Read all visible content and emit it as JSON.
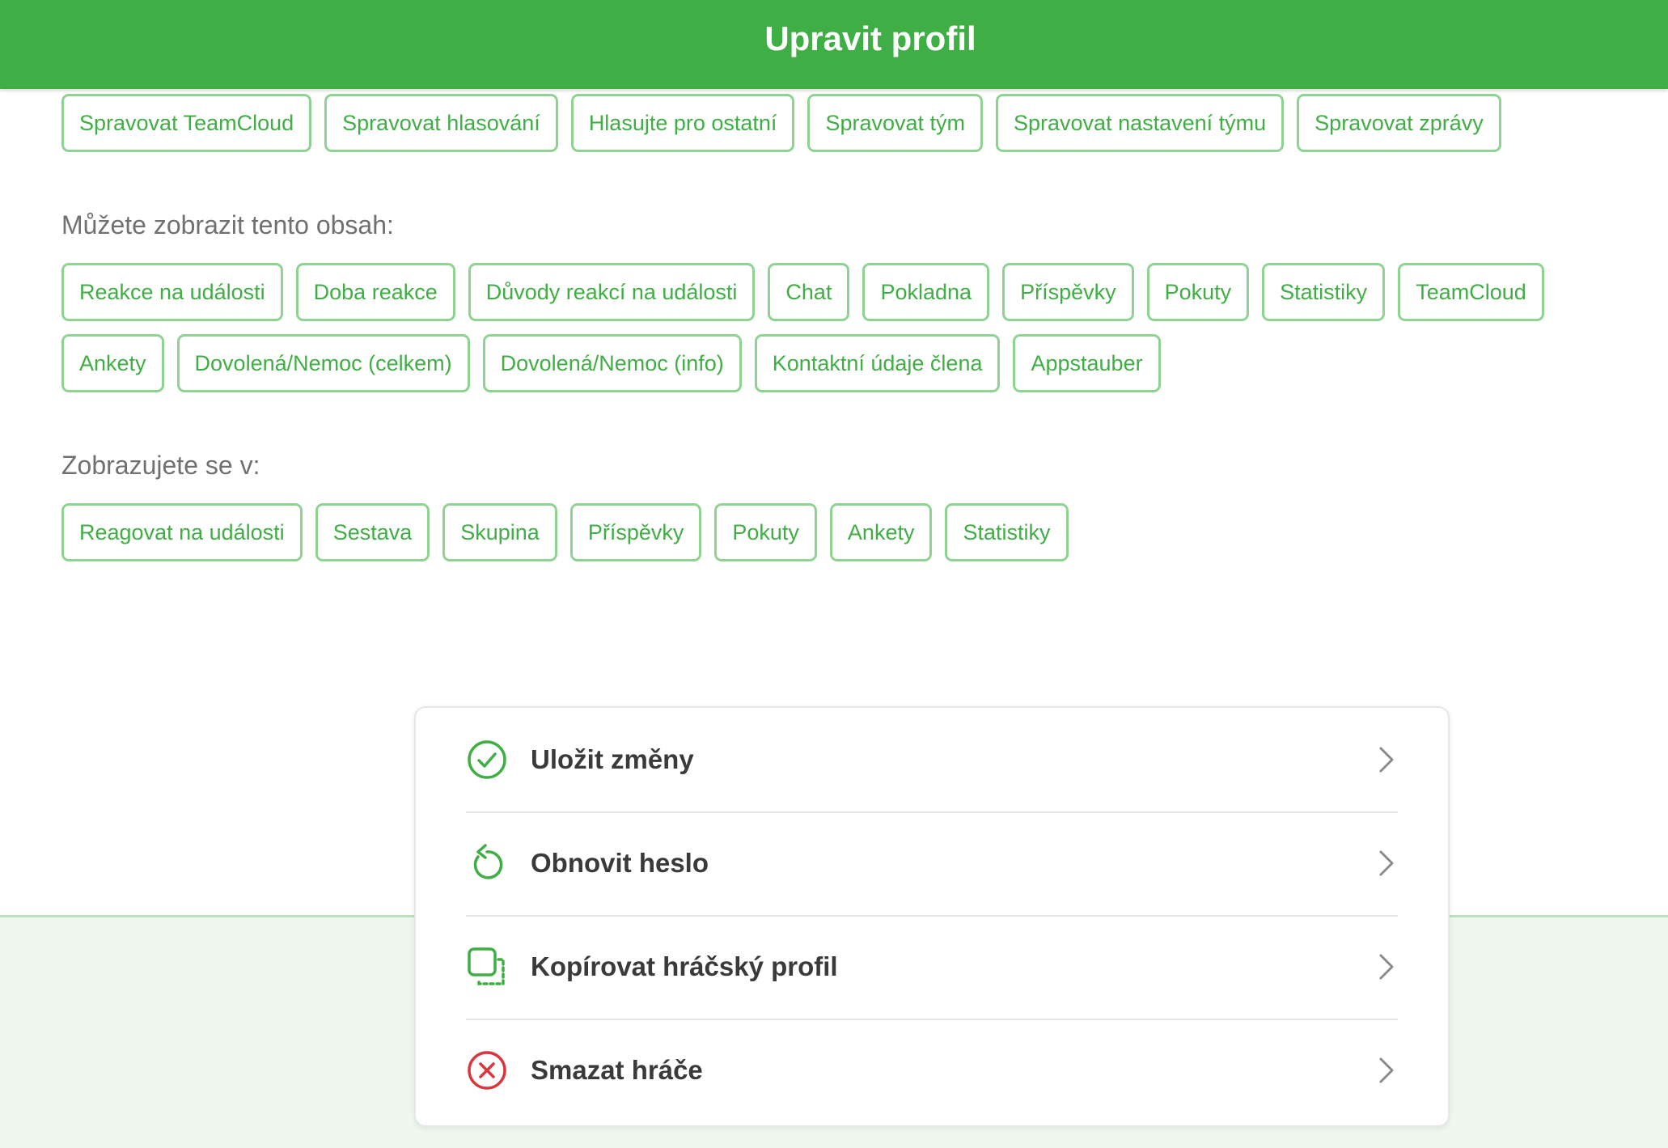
{
  "header": {
    "title": "Upravit profil"
  },
  "permissions": {
    "chips": [
      "Spravovat TeamCloud",
      "Spravovat hlasování",
      "Hlasujte pro ostatní",
      "Spravovat tým",
      "Spravovat nastavení týmu",
      "Spravovat zprávy"
    ]
  },
  "visible_content": {
    "label": "Můžete zobrazit tento obsah:",
    "chips": [
      "Reakce na události",
      "Doba reakce",
      "Důvody reakcí na události",
      "Chat",
      "Pokladna",
      "Příspěvky",
      "Pokuty",
      "Statistiky",
      "TeamCloud",
      "Ankety",
      "Dovolená/Nemoc (celkem)",
      "Dovolená/Nemoc (info)",
      "Kontaktní údaje člena",
      "Appstauber"
    ]
  },
  "appears_in": {
    "label": "Zobrazujete se v:",
    "chips": [
      "Reagovat na události",
      "Sestava",
      "Skupina",
      "Příspěvky",
      "Pokuty",
      "Ankety",
      "Statistiky"
    ]
  },
  "actions": {
    "items": [
      {
        "label": "Uložit změny",
        "icon": "check-circle-icon"
      },
      {
        "label": "Obnovit heslo",
        "icon": "reset-icon"
      },
      {
        "label": "Kopírovat hráčský profil",
        "icon": "copy-icon"
      },
      {
        "label": "Smazat hráče",
        "icon": "delete-circle-icon"
      }
    ]
  },
  "colors": {
    "brand_green": "#3fae44",
    "chip_border": "#8fd393",
    "danger_red": "#d9363e",
    "footer_band": "#eef8ef"
  }
}
